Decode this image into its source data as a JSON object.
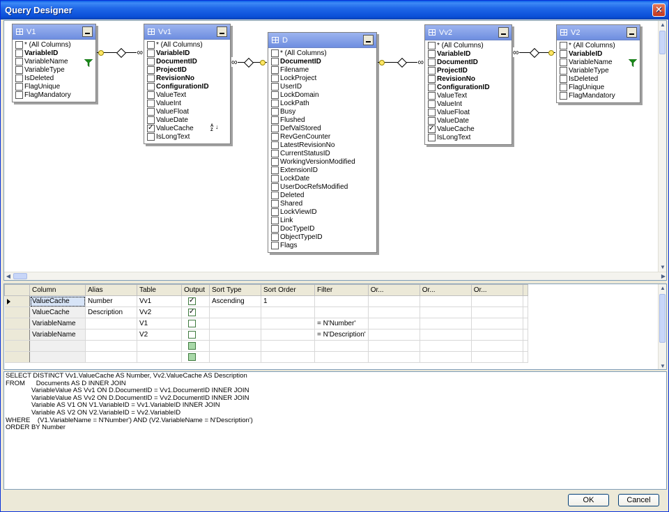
{
  "window": {
    "title": "Query Designer",
    "close_symbol": "✕"
  },
  "diagram": {
    "tables": [
      {
        "id": "V1",
        "title": "V1",
        "columns": [
          {
            "label": "* (All Columns)",
            "checked": false,
            "bold": false
          },
          {
            "label": "VariableID",
            "checked": false,
            "bold": true
          },
          {
            "label": "VariableName",
            "checked": false,
            "bold": false
          },
          {
            "label": "VariableType",
            "checked": false,
            "bold": false
          },
          {
            "label": "IsDeleted",
            "checked": false,
            "bold": false
          },
          {
            "label": "FlagUnique",
            "checked": false,
            "bold": false
          },
          {
            "label": "FlagMandatory",
            "checked": false,
            "bold": false
          }
        ]
      },
      {
        "id": "Vv1",
        "title": "Vv1",
        "columns": [
          {
            "label": "* (All Columns)",
            "checked": false,
            "bold": false
          },
          {
            "label": "VariableID",
            "checked": false,
            "bold": true
          },
          {
            "label": "DocumentID",
            "checked": false,
            "bold": true
          },
          {
            "label": "ProjectID",
            "checked": false,
            "bold": true
          },
          {
            "label": "RevisionNo",
            "checked": false,
            "bold": true
          },
          {
            "label": "ConfigurationID",
            "checked": false,
            "bold": true
          },
          {
            "label": "ValueText",
            "checked": false,
            "bold": false
          },
          {
            "label": "ValueInt",
            "checked": false,
            "bold": false
          },
          {
            "label": "ValueFloat",
            "checked": false,
            "bold": false
          },
          {
            "label": "ValueDate",
            "checked": false,
            "bold": false
          },
          {
            "label": "ValueCache",
            "checked": true,
            "bold": false
          },
          {
            "label": "IsLongText",
            "checked": false,
            "bold": false
          }
        ]
      },
      {
        "id": "D",
        "title": "D",
        "columns": [
          {
            "label": "* (All Columns)",
            "checked": false,
            "bold": false
          },
          {
            "label": "DocumentID",
            "checked": false,
            "bold": true
          },
          {
            "label": "Filename",
            "checked": false,
            "bold": false
          },
          {
            "label": "LockProject",
            "checked": false,
            "bold": false
          },
          {
            "label": "UserID",
            "checked": false,
            "bold": false
          },
          {
            "label": "LockDomain",
            "checked": false,
            "bold": false
          },
          {
            "label": "LockPath",
            "checked": false,
            "bold": false
          },
          {
            "label": "Busy",
            "checked": false,
            "bold": false
          },
          {
            "label": "Flushed",
            "checked": false,
            "bold": false
          },
          {
            "label": "DefValStored",
            "checked": false,
            "bold": false
          },
          {
            "label": "RevGenCounter",
            "checked": false,
            "bold": false
          },
          {
            "label": "LatestRevisionNo",
            "checked": false,
            "bold": false
          },
          {
            "label": "CurrentStatusID",
            "checked": false,
            "bold": false
          },
          {
            "label": "WorkingVersionModified",
            "checked": false,
            "bold": false
          },
          {
            "label": "ExtensionID",
            "checked": false,
            "bold": false
          },
          {
            "label": "LockDate",
            "checked": false,
            "bold": false
          },
          {
            "label": "UserDocRefsModified",
            "checked": false,
            "bold": false
          },
          {
            "label": "Deleted",
            "checked": false,
            "bold": false
          },
          {
            "label": "Shared",
            "checked": false,
            "bold": false
          },
          {
            "label": "LockViewID",
            "checked": false,
            "bold": false
          },
          {
            "label": "Link",
            "checked": false,
            "bold": false
          },
          {
            "label": "DocTypeID",
            "checked": false,
            "bold": false
          },
          {
            "label": "ObjectTypeID",
            "checked": false,
            "bold": false
          },
          {
            "label": "Flags",
            "checked": false,
            "bold": false
          }
        ]
      },
      {
        "id": "Vv2",
        "title": "Vv2",
        "columns": [
          {
            "label": "* (All Columns)",
            "checked": false,
            "bold": false
          },
          {
            "label": "VariableID",
            "checked": false,
            "bold": true
          },
          {
            "label": "DocumentID",
            "checked": false,
            "bold": true
          },
          {
            "label": "ProjectID",
            "checked": false,
            "bold": true
          },
          {
            "label": "RevisionNo",
            "checked": false,
            "bold": true
          },
          {
            "label": "ConfigurationID",
            "checked": false,
            "bold": true
          },
          {
            "label": "ValueText",
            "checked": false,
            "bold": false
          },
          {
            "label": "ValueInt",
            "checked": false,
            "bold": false
          },
          {
            "label": "ValueFloat",
            "checked": false,
            "bold": false
          },
          {
            "label": "ValueDate",
            "checked": false,
            "bold": false
          },
          {
            "label": "ValueCache",
            "checked": true,
            "bold": false
          },
          {
            "label": "IsLongText",
            "checked": false,
            "bold": false
          }
        ]
      },
      {
        "id": "V2",
        "title": "V2",
        "columns": [
          {
            "label": "* (All Columns)",
            "checked": false,
            "bold": false
          },
          {
            "label": "VariableID",
            "checked": false,
            "bold": true
          },
          {
            "label": "VariableName",
            "checked": false,
            "bold": false
          },
          {
            "label": "VariableType",
            "checked": false,
            "bold": false
          },
          {
            "label": "IsDeleted",
            "checked": false,
            "bold": false
          },
          {
            "label": "FlagUnique",
            "checked": false,
            "bold": false
          },
          {
            "label": "FlagMandatory",
            "checked": false,
            "bold": false
          }
        ]
      }
    ],
    "icons": {
      "filter": "filter-icon",
      "sort": "sort-ascending-icon",
      "sort_symbol": "↓",
      "sort_letters": "AZ"
    }
  },
  "grid": {
    "headers": [
      "Column",
      "Alias",
      "Table",
      "Output",
      "Sort Type",
      "Sort Order",
      "Filter",
      "Or...",
      "Or...",
      "Or..."
    ],
    "rows": [
      {
        "column": "ValueCache",
        "alias": "Number",
        "table": "Vv1",
        "output": true,
        "sort_type": "Ascending",
        "sort_order": "1",
        "filter": ""
      },
      {
        "column": "ValueCache",
        "alias": "Description",
        "table": "Vv2",
        "output": true,
        "sort_type": "",
        "sort_order": "",
        "filter": ""
      },
      {
        "column": "VariableName",
        "alias": "",
        "table": "V1",
        "output": false,
        "sort_type": "",
        "sort_order": "",
        "filter": "= N'Number'"
      },
      {
        "column": "VariableName",
        "alias": "",
        "table": "V2",
        "output": false,
        "sort_type": "",
        "sort_order": "",
        "filter": "= N'Description'"
      },
      {
        "column": "",
        "alias": "",
        "table": "",
        "output": "dim",
        "sort_type": "",
        "sort_order": "",
        "filter": ""
      },
      {
        "column": "",
        "alias": "",
        "table": "",
        "output": "dim",
        "sort_type": "",
        "sort_order": "",
        "filter": ""
      }
    ]
  },
  "sql": {
    "lines": [
      "SELECT DISTINCT Vv1.ValueCache AS Number, Vv2.ValueCache AS Description",
      "FROM      Documents AS D INNER JOIN",
      "              VariableValue AS Vv1 ON D.DocumentID = Vv1.DocumentID INNER JOIN",
      "              VariableValue AS Vv2 ON D.DocumentID = Vv2.DocumentID INNER JOIN",
      "              Variable AS V1 ON V1.VariableID = Vv1.VariableID INNER JOIN",
      "              Variable AS V2 ON V2.VariableID = Vv2.VariableID",
      "WHERE    (V1.VariableName = N'Number') AND (V2.VariableName = N'Description')",
      "ORDER BY Number"
    ]
  },
  "buttons": {
    "ok": "OK",
    "cancel": "Cancel"
  }
}
